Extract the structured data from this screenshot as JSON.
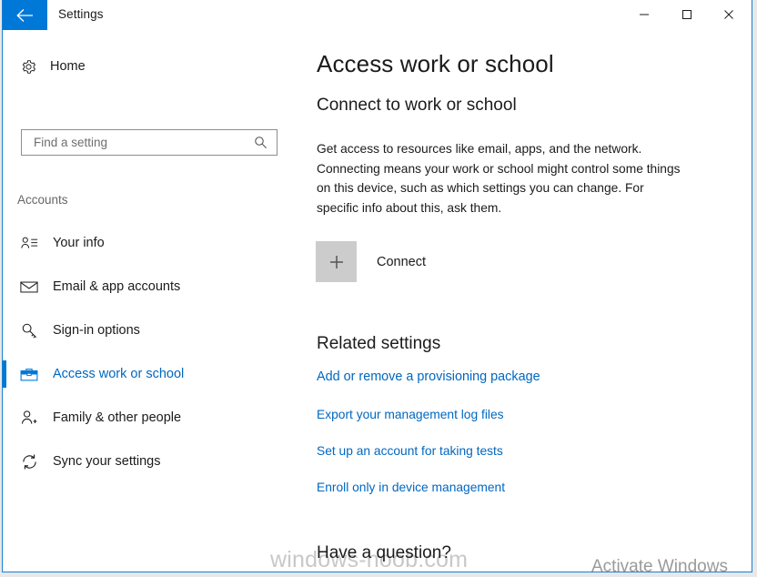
{
  "window": {
    "title": "Settings",
    "accent_color": "#0078d7",
    "link_color": "#0067c0",
    "border_color": "#1a7fd4",
    "back_button_icon": "back-arrow-icon",
    "caption_buttons": [
      {
        "name": "minimize-button",
        "icon": "minimize-icon",
        "label": "Minimize"
      },
      {
        "name": "maximize-button",
        "icon": "maximize-icon",
        "label": "Maximize"
      },
      {
        "name": "close-button",
        "icon": "close-icon",
        "label": "Close"
      }
    ]
  },
  "sidebar": {
    "home": {
      "label": "Home",
      "icon": "gear-icon"
    },
    "search": {
      "value": "",
      "placeholder": "Find a setting",
      "icon": "search-icon"
    },
    "category": "Accounts",
    "items": [
      {
        "label": "Your info",
        "icon": "user-info-icon",
        "selected": false
      },
      {
        "label": "Email & app accounts",
        "icon": "envelope-icon",
        "selected": false
      },
      {
        "label": "Sign-in options",
        "icon": "key-icon",
        "selected": false
      },
      {
        "label": "Access work or school",
        "icon": "briefcase-icon",
        "selected": true
      },
      {
        "label": "Family & other people",
        "icon": "user-add-icon",
        "selected": false
      },
      {
        "label": "Sync your settings",
        "icon": "sync-icon",
        "selected": false
      }
    ]
  },
  "main": {
    "page_title": "Access work or school",
    "section_heading": "Connect to work or school",
    "description": "Get access to resources like email, apps, and the network. Connecting means your work or school might control some things on this device, such as which settings you can change. For specific info about this, ask them.",
    "connect": {
      "label": "Connect",
      "icon": "plus-icon"
    },
    "related_heading": "Related settings",
    "related_links": [
      "Add or remove a provisioning package",
      "Export your management log files",
      "Set up an account for taking tests",
      "Enroll only in device management"
    ],
    "question_heading": "Have a question?"
  },
  "watermarks": {
    "site": "windows-noob.com",
    "activation": "Activate Windows"
  }
}
